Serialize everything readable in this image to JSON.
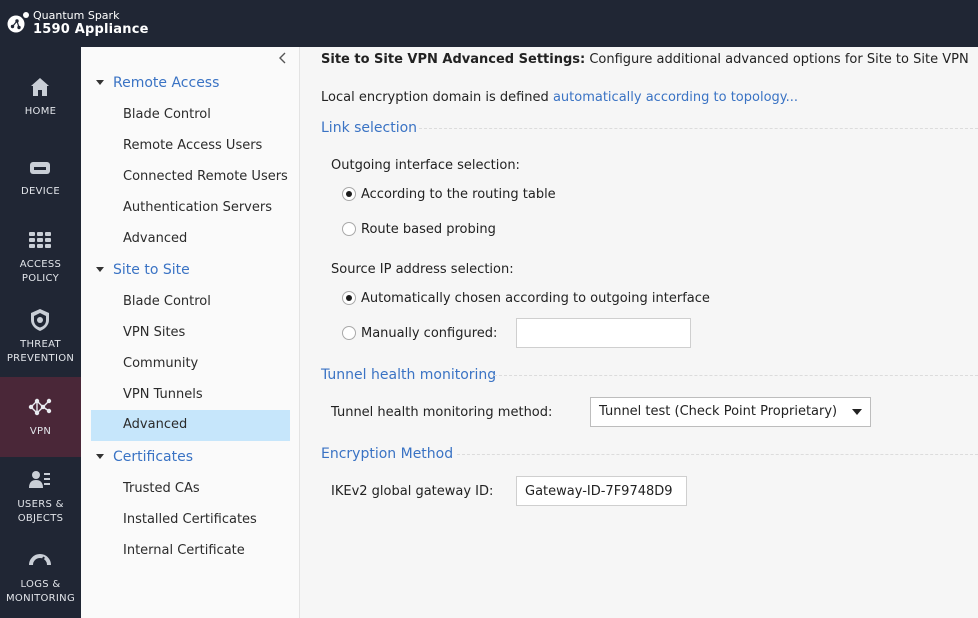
{
  "header": {
    "brand_line1": "Quantum Spark",
    "brand_line2": "1590 Appliance",
    "logo_icon": "quantum-spark-logo"
  },
  "left_nav": {
    "items": [
      {
        "label": "HOME",
        "icon": "house-icon"
      },
      {
        "label": "DEVICE",
        "icon": "router-icon"
      },
      {
        "label_line1": "ACCESS",
        "label_line2": "POLICY",
        "icon": "policy-grid-icon"
      },
      {
        "label_line1": "THREAT",
        "label_line2": "PREVENTION",
        "icon": "shield-icon"
      },
      {
        "label": "VPN",
        "icon": "vpn-network-icon",
        "active": true
      },
      {
        "label_line1": "USERS &",
        "label_line2": "OBJECTS",
        "icon": "users-icon"
      },
      {
        "label_line1": "LOGS &",
        "label_line2": "MONITORING",
        "icon": "gauge-icon"
      }
    ],
    "active_color": "#4a2738",
    "background": "#202634"
  },
  "tree": {
    "sections": [
      {
        "label": "Remote Access",
        "items": [
          "Blade Control",
          "Remote Access Users",
          "Connected Remote Users",
          "Authentication Servers",
          "Advanced"
        ]
      },
      {
        "label": "Site to Site",
        "items": [
          "Blade Control",
          "VPN Sites",
          "Community",
          "VPN Tunnels",
          "Advanced"
        ]
      },
      {
        "label": "Certificates",
        "items": [
          "Trusted CAs",
          "Installed Certificates",
          "Internal Certificate"
        ]
      }
    ],
    "selected": "Site to Site / Advanced",
    "selected_color": "#c6e6fb"
  },
  "main": {
    "title_bold": "Site to Site VPN Advanced Settings:",
    "title_rest": "Configure additional advanced options for Site to Site VPN",
    "enc_domain_prefix": "Local encryption domain is defined",
    "enc_domain_link": "automatically according to topology...",
    "link_selection": {
      "heading": "Link selection",
      "outgoing_label": "Outgoing interface selection:",
      "outgoing_options": [
        {
          "label": "According to the routing table",
          "checked": true
        },
        {
          "label": "Route based probing",
          "checked": false
        }
      ],
      "source_label": "Source IP address selection:",
      "source_options": [
        {
          "label": "Automatically chosen according to outgoing interface",
          "checked": true
        },
        {
          "label": "Manually configured:",
          "checked": false
        }
      ],
      "manual_value": ""
    },
    "tunnel_health": {
      "heading": "Tunnel health monitoring",
      "method_label": "Tunnel health monitoring method:",
      "method_value": "Tunnel test (Check Point Proprietary)"
    },
    "encryption": {
      "heading": "Encryption Method",
      "ikev2_label": "IKEv2 global gateway ID:",
      "ikev2_value": "Gateway-ID-7F9748D9"
    },
    "link_color": "#3a73c4"
  }
}
